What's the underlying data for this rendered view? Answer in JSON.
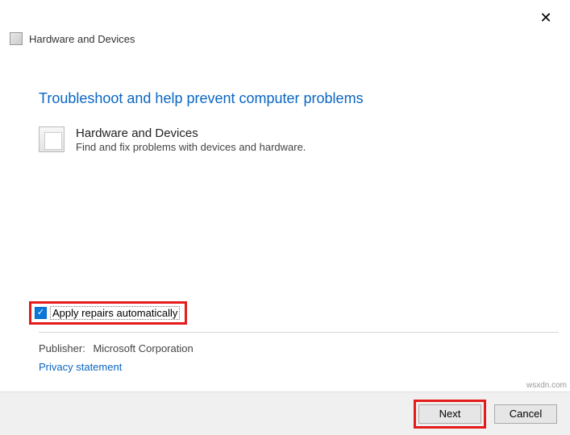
{
  "window": {
    "close_glyph": "✕",
    "title": "Hardware and Devices"
  },
  "main": {
    "heading": "Troubleshoot and help prevent computer problems",
    "troubleshooter": {
      "title": "Hardware and Devices",
      "description": "Find and fix problems with devices and hardware."
    }
  },
  "options": {
    "apply_repairs_label": "Apply repairs automatically",
    "apply_repairs_checked": true
  },
  "meta": {
    "publisher_label": "Publisher:",
    "publisher_value": "Microsoft Corporation",
    "privacy_link": "Privacy statement"
  },
  "footer": {
    "next_label": "Next",
    "cancel_label": "Cancel"
  },
  "watermark": "wsxdn.com"
}
